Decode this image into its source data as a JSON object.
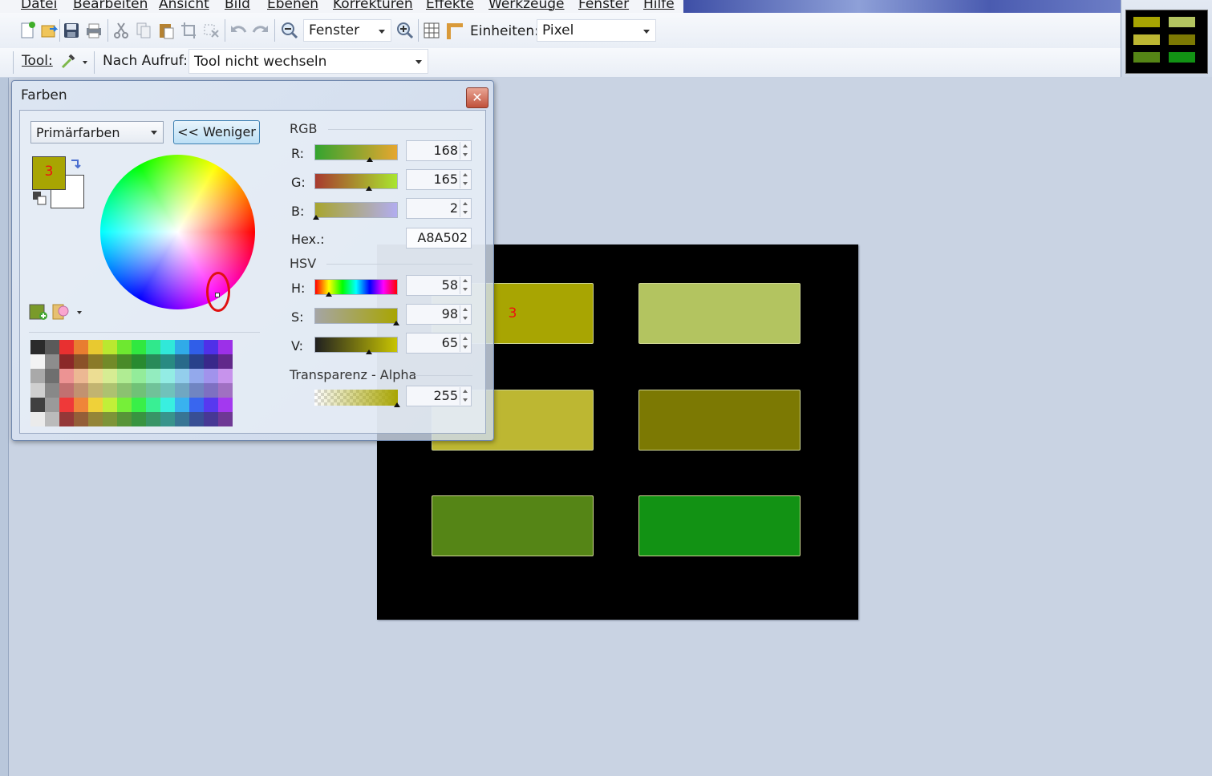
{
  "menubar": {
    "items": [
      {
        "label": "Datei"
      },
      {
        "label": "Bearbeiten"
      },
      {
        "label": "Ansicht"
      },
      {
        "label": "Bild"
      },
      {
        "label": "Ebenen"
      },
      {
        "label": "Korrekturen"
      },
      {
        "label": "Effekte"
      },
      {
        "label": "Werkzeuge"
      },
      {
        "label": "Fenster"
      },
      {
        "label": "Hilfe"
      }
    ]
  },
  "toolbar": {
    "zoom_value": "Fenster",
    "units_label": "Einheiten:",
    "units_value": "Pixel",
    "tool_label": "Tool:",
    "after_label": "Nach Aufruf:",
    "after_value": "Tool nicht wechseln",
    "icons": [
      "new-icon",
      "open-icon",
      "save-icon",
      "print-icon",
      "cut-icon",
      "copy-icon",
      "paste-icon",
      "crop-icon",
      "deselect-icon",
      "undo-icon",
      "redo-icon",
      "zoom-out-icon",
      "zoom-in-icon",
      "grid-icon",
      "ruler-icon",
      "color-picker-icon"
    ]
  },
  "colors_dialog": {
    "title": "Farben",
    "close_label": "✕",
    "mode_dropdown": "Primärfarben",
    "less_button": "<< Weniger",
    "primary_number": "3",
    "primary_color": "#A8A502",
    "secondary_color": "#FFFFFF",
    "rgb_header": "RGB",
    "r_label": "R:",
    "r_value": "168",
    "g_label": "G:",
    "g_value": "165",
    "b_label": "B:",
    "b_value": "2",
    "hex_label": "Hex.:",
    "hex_value": "A8A502",
    "hsv_header": "HSV",
    "h_label": "H:",
    "h_value": "58",
    "s_label": "S:",
    "s_value": "98",
    "v_label": "V:",
    "v_value": "65",
    "alpha_header": "Transparenz - Alpha",
    "alpha_value": "255"
  },
  "canvas": {
    "swatches": [
      {
        "color": "#A8A502",
        "number": "3"
      },
      {
        "color": "#B3C460",
        "number": ""
      },
      {
        "color": "#BDB732",
        "number": ""
      },
      {
        "color": "#7C7903",
        "number": ""
      },
      {
        "color": "#558516",
        "number": ""
      },
      {
        "color": "#129214",
        "number": ""
      }
    ]
  },
  "thumbnail": {
    "colors": [
      "#A8A502",
      "#B3C460",
      "#BDB732",
      "#7C7903",
      "#558516",
      "#129214"
    ]
  }
}
